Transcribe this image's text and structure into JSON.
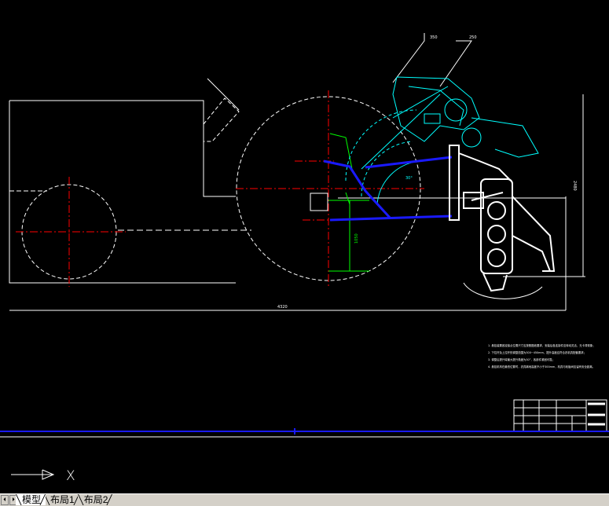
{
  "tabs": {
    "model": "模型",
    "layout1": "布局1",
    "layout2": "布局2"
  },
  "nav": {
    "first": "⏴",
    "last": "⏵"
  },
  "dimensions": {
    "overall_length": "4320",
    "height_right": "2480",
    "vertical_dim": "1050",
    "angle": "30°",
    "leader_1": "350",
    "leader_2": "250"
  },
  "notes": [
    "1. 悬挂装置各铰接点位置尺寸应按照图纸要求，安装后各连接件应转动灵活，无卡滞现象；",
    "2. 下拉杆及上拉杆的调整范围为300~450mm，提升高度应符合农机具配套要求；",
    "3. 调整后提升臂最大提升角度为30°，各部件紧固可靠；",
    "4. 悬挂机构在最低位置时，农具离地高度不小于300mm，机具与轮胎间应留有安全距离。"
  ],
  "colors": {
    "background": "#000000",
    "line": "#ffffff",
    "centerline": "#ff0000",
    "dimension": "#00ff00",
    "linkage": "#0000ff",
    "implement": "#00ffff",
    "ucs_icon": "#ffffff"
  },
  "ucs": {
    "x_label": "X"
  }
}
